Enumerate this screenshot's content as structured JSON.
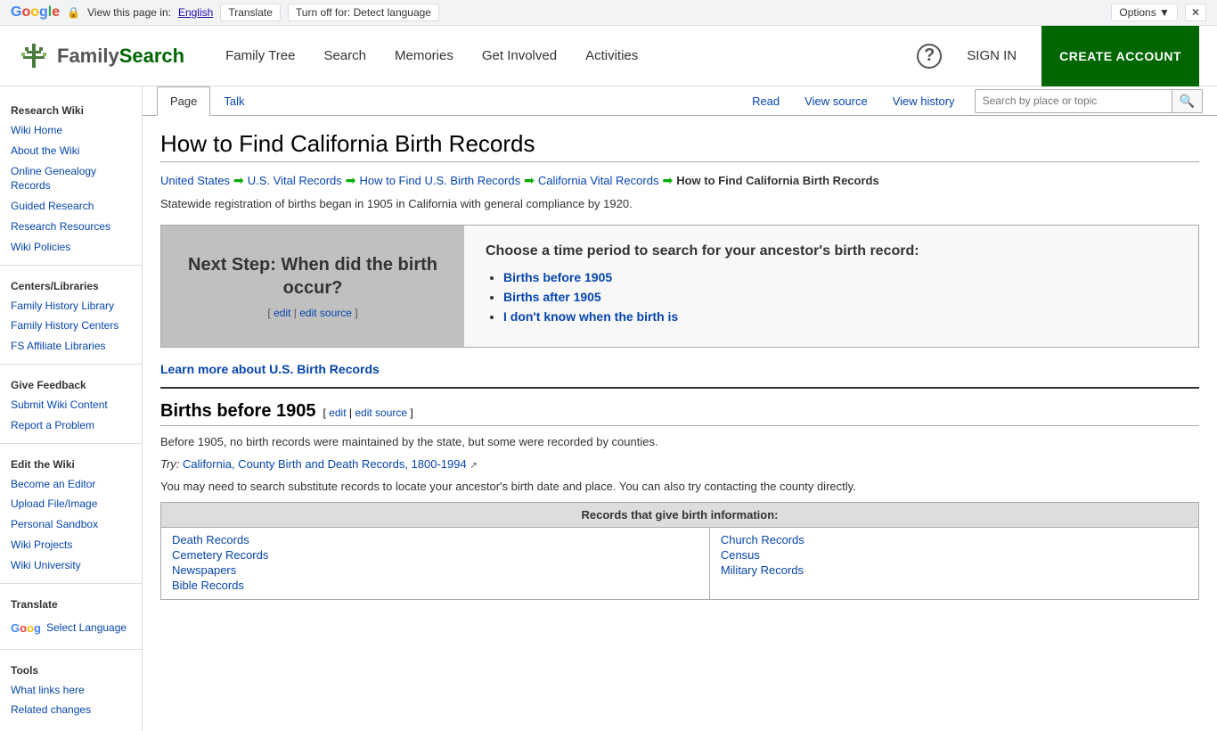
{
  "translate_bar": {
    "label": "View this page in:",
    "lang": "English",
    "translate_btn": "Translate",
    "turn_off_btn": "Turn off for: Detect language",
    "options_btn": "Options ▼",
    "close_btn": "✕"
  },
  "header": {
    "logo_text": "FamilySearch",
    "nav": [
      {
        "label": "Family Tree"
      },
      {
        "label": "Search"
      },
      {
        "label": "Memories"
      },
      {
        "label": "Get Involved"
      },
      {
        "label": "Activities"
      }
    ],
    "sign_in": "SIGN IN",
    "create_account": "CREATE ACCOUNT"
  },
  "sidebar": {
    "section_research_wiki": "Research Wiki",
    "links_research": [
      {
        "label": "Wiki Home"
      },
      {
        "label": "About the Wiki"
      },
      {
        "label": "Online Genealogy Records"
      },
      {
        "label": "Guided Research"
      },
      {
        "label": "Research Resources"
      },
      {
        "label": "Wiki Policies"
      }
    ],
    "section_centers": "Centers/Libraries",
    "links_centers": [
      {
        "label": "Family History Library"
      },
      {
        "label": "Family History Centers"
      },
      {
        "label": "FS Affiliate Libraries"
      }
    ],
    "section_feedback": "Give Feedback",
    "links_feedback": [
      {
        "label": "Submit Wiki Content"
      },
      {
        "label": "Report a Problem"
      }
    ],
    "section_edit": "Edit the Wiki",
    "links_edit": [
      {
        "label": "Become an Editor"
      },
      {
        "label": "Upload File/Image"
      },
      {
        "label": "Personal Sandbox"
      },
      {
        "label": "Wiki Projects"
      },
      {
        "label": "Wiki University"
      }
    ],
    "section_translate": "Translate",
    "select_language": "Select Language",
    "section_tools": "Tools",
    "links_tools": [
      {
        "label": "What links here"
      },
      {
        "label": "Related changes"
      }
    ]
  },
  "page_tabs": {
    "tab_page": "Page",
    "tab_talk": "Talk",
    "tab_read": "Read",
    "tab_view_source": "View source",
    "tab_view_history": "View history",
    "search_placeholder": "Search by place or topic"
  },
  "article": {
    "title": "How to Find California Birth Records",
    "breadcrumb": [
      {
        "label": "United States",
        "current": false
      },
      {
        "label": "U.S. Vital Records",
        "current": false
      },
      {
        "label": "How to Find U.S. Birth Records",
        "current": false
      },
      {
        "label": "California Vital Records",
        "current": false
      },
      {
        "label": "How to Find California Birth Records",
        "current": true
      }
    ],
    "intro": "Statewide registration of births began in 1905 in California with general compliance by 1920.",
    "decision_box": {
      "left_title": "Next Step: When did the birth occur?",
      "edit_label": "[ edit | edit source ]",
      "right_heading": "Choose a time period to search for your ancestor's birth record:",
      "options": [
        {
          "label": "Births before 1905"
        },
        {
          "label": "Births after 1905"
        },
        {
          "label": "I don't know when the birth is"
        }
      ]
    },
    "learn_more": "Learn more about U.S. Birth Records",
    "section1": {
      "heading": "Births before 1905",
      "edit_links": "[ edit | edit source ]",
      "text": "Before 1905, no birth records were maintained by the state, but some were recorded by counties.",
      "try_label": "Try:",
      "try_link_text": "California, County Birth and Death Records, 1800-1994",
      "sub_text": "You may need to search substitute records to locate your ancestor's birth date and place. You can also try contacting the county directly.",
      "records_table": {
        "header": "Records that give birth information:",
        "col1_records": [
          {
            "label": "Death Records"
          },
          {
            "label": "Cemetery Records"
          },
          {
            "label": "Newspapers"
          },
          {
            "label": "Bible Records"
          }
        ],
        "col2_records": [
          {
            "label": "Church Records"
          },
          {
            "label": "Census"
          },
          {
            "label": "Military Records"
          }
        ]
      }
    }
  }
}
